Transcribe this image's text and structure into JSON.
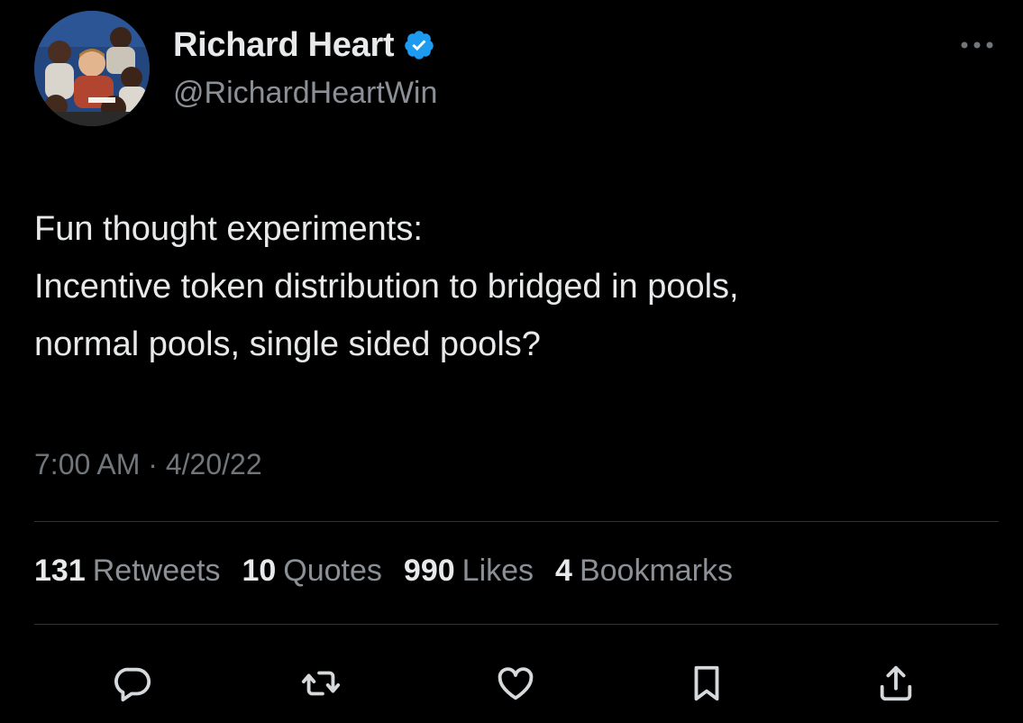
{
  "author": {
    "display_name": "Richard Heart",
    "handle": "@RichardHeartWin",
    "verified_color": "#1d9bf0"
  },
  "tweet": {
    "lines": [
      "Fun thought experiments:",
      "Incentive token distribution to bridged in pools,",
      "normal pools, single sided pools?"
    ],
    "time": "7:00 AM",
    "separator": "·",
    "date": "4/20/22"
  },
  "stats": [
    {
      "count": "131",
      "label": "Retweets"
    },
    {
      "count": "10",
      "label": "Quotes"
    },
    {
      "count": "990",
      "label": "Likes"
    },
    {
      "count": "4",
      "label": "Bookmarks"
    }
  ],
  "actions": {
    "reply_icon": "reply-icon",
    "retweet_icon": "retweet-icon",
    "like_icon": "heart-icon",
    "bookmark_icon": "bookmark-icon",
    "share_icon": "share-icon",
    "more_icon": "more-dots-icon"
  },
  "colors": {
    "background": "#000000",
    "text_primary": "#e7e9ea",
    "text_secondary": "#71767b",
    "divider": "#2f3336"
  }
}
